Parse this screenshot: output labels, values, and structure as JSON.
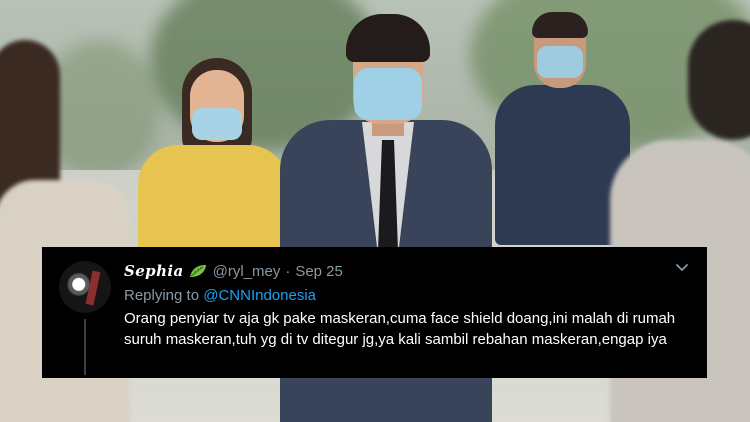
{
  "tweet": {
    "display_name": "Sephia",
    "handle": "@ryl_mey",
    "separator": "·",
    "date": "Sep 25",
    "replying_label": "Replying to",
    "replying_to": "@CNNIndonesia",
    "text": "Orang penyiar tv aja gk pake maskeran,cuma face shield doang,ini malah di rumah suruh maskeran,tuh yg di tv ditegur jg,ya kali sambil rebahan maskeran,engap   iya",
    "name_emoji_icon": "leaf-icon",
    "menu_icon": "chevron-down-icon"
  },
  "colors": {
    "tweet_background": "#000000",
    "muted_text": "#8899a6",
    "mention": "#1da1f2"
  }
}
